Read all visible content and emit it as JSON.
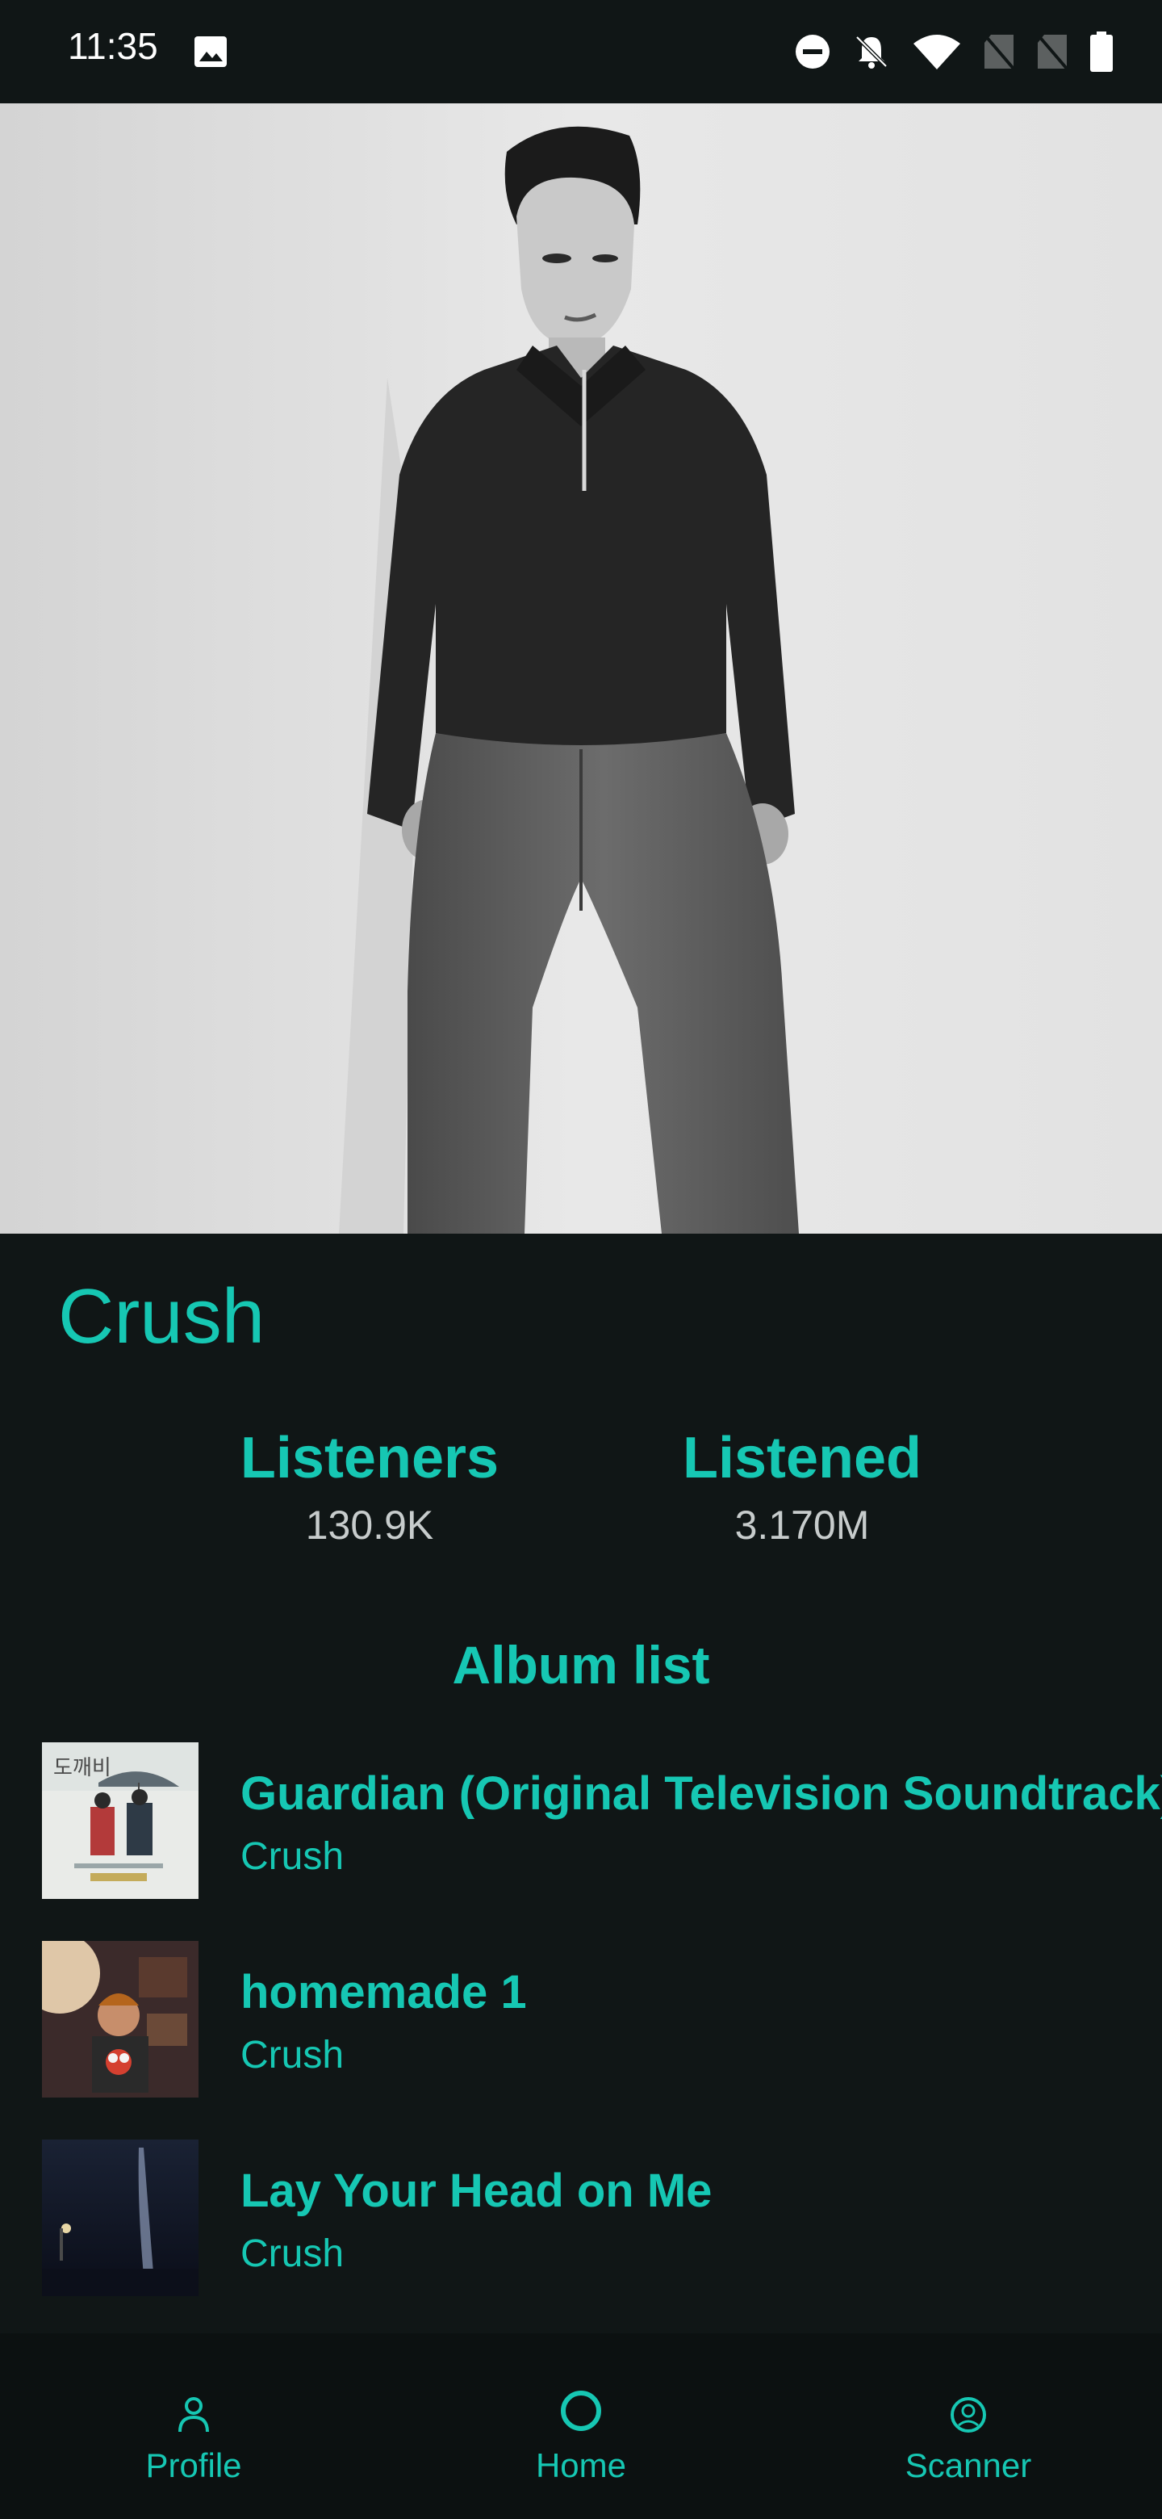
{
  "status_bar": {
    "time": "11:35"
  },
  "artist": {
    "name": "Crush"
  },
  "stats": {
    "listeners_label": "Listeners",
    "listeners_value": "130.9K",
    "listened_label": "Listened",
    "listened_value": "3.170M"
  },
  "album_list": {
    "heading": "Album list",
    "items": [
      {
        "title": "Guardian (Original Television Soundtrack)",
        "artist": "Crush"
      },
      {
        "title": "homemade 1",
        "artist": "Crush"
      },
      {
        "title": "Lay Your Head on Me",
        "artist": "Crush"
      }
    ]
  },
  "nav": {
    "profile": "Profile",
    "home": "Home",
    "scanner": "Scanner"
  },
  "colors": {
    "accent": "#16c7b3",
    "background": "#101616",
    "nav_background": "#0c1111"
  },
  "icons": {
    "status_left": "image-icon",
    "status_right": [
      "dnd-icon",
      "bell-off-icon",
      "wifi-icon",
      "no-sim-icon",
      "no-sim-icon",
      "battery-icon"
    ],
    "nav": [
      "person-icon",
      "circle-icon",
      "face-scan-icon"
    ]
  }
}
